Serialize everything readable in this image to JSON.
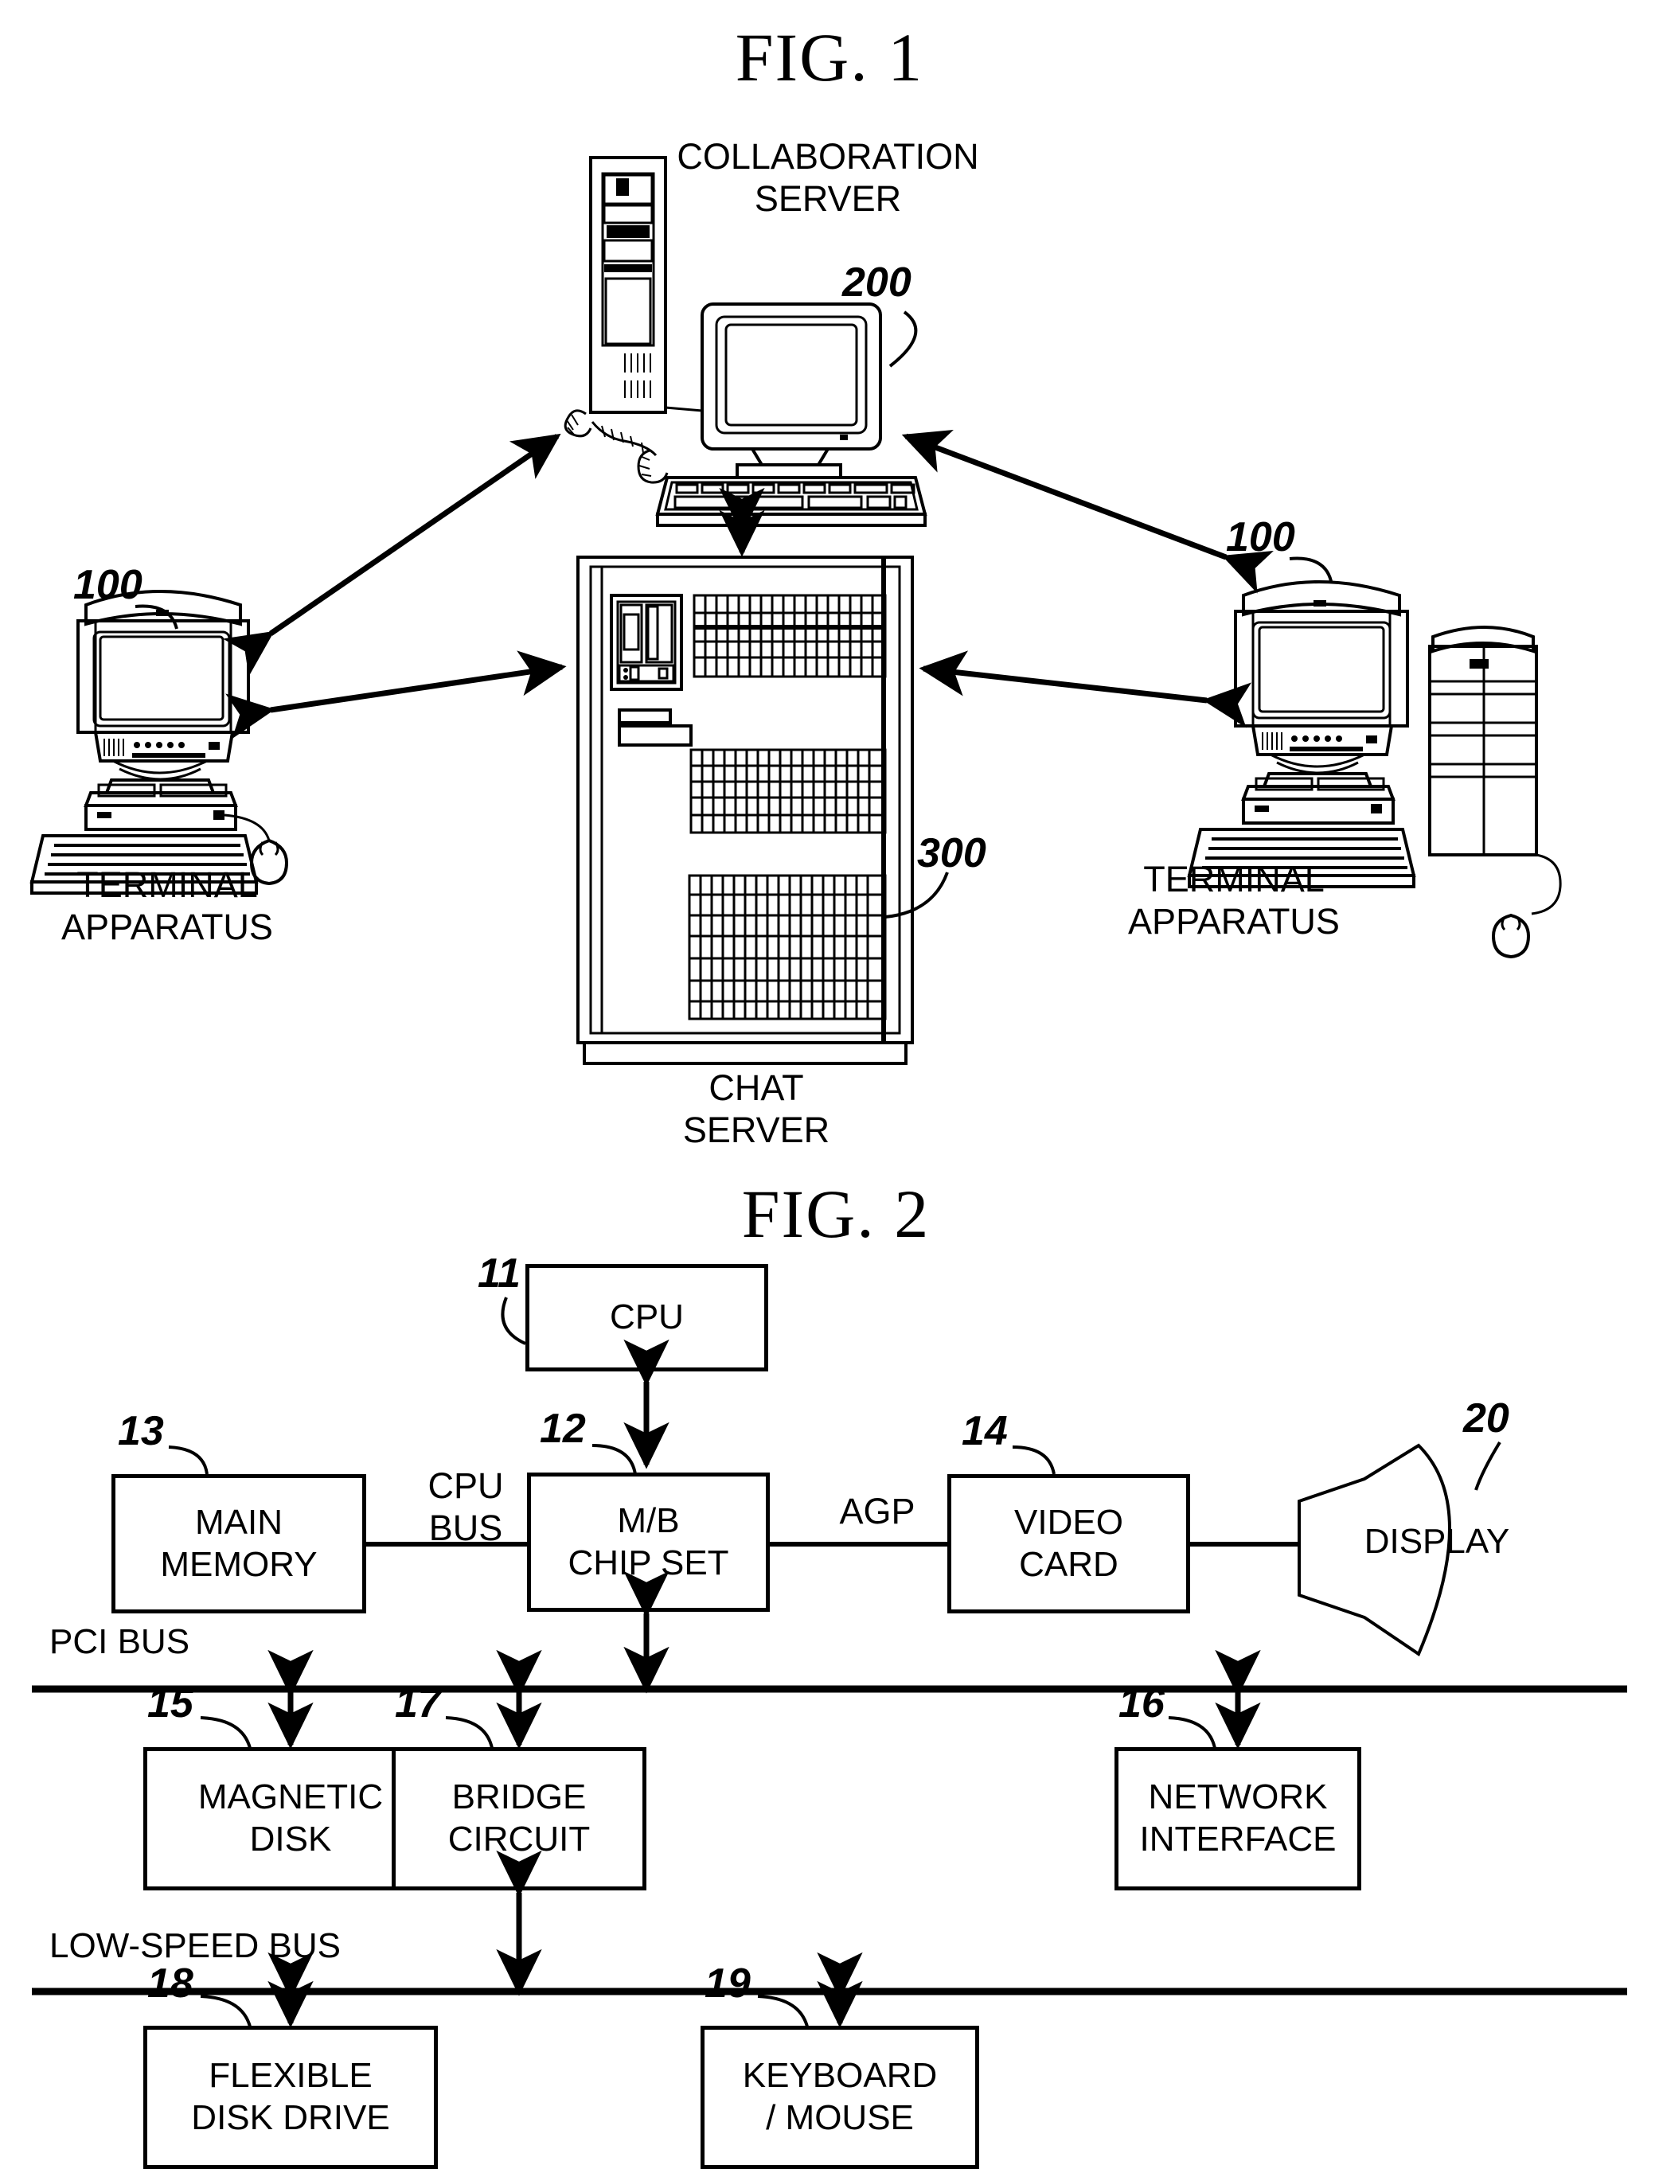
{
  "figures": [
    {
      "title": "FIG. 1",
      "nodes": {
        "collaboration_server": {
          "label": "COLLABORATION\nSERVER",
          "ref": "200"
        },
        "terminal_left": {
          "label": "TERMINAL\nAPPARATUS",
          "ref": "100"
        },
        "terminal_right": {
          "label": "TERMINAL\nAPPARATUS",
          "ref": "100"
        },
        "chat_server": {
          "label": "CHAT\nSERVER",
          "ref": "300"
        }
      }
    },
    {
      "title": "FIG. 2",
      "blocks": [
        {
          "key": "cpu",
          "label": "CPU",
          "ref": "11"
        },
        {
          "key": "chipset",
          "label": "M/B\nCHIP SET",
          "ref": "12"
        },
        {
          "key": "main_memory",
          "label": "MAIN\nMEMORY",
          "ref": "13"
        },
        {
          "key": "video_card",
          "label": "VIDEO\nCARD",
          "ref": "14"
        },
        {
          "key": "display",
          "label": "DISPLAY",
          "ref": "20"
        },
        {
          "key": "magnetic_disk",
          "label": "MAGNETIC\nDISK",
          "ref": "15"
        },
        {
          "key": "bridge",
          "label": "BRIDGE\nCIRCUIT",
          "ref": "17"
        },
        {
          "key": "network",
          "label": "NETWORK\nINTERFACE",
          "ref": "16"
        },
        {
          "key": "fdd",
          "label": "FLEXIBLE\nDISK DRIVE",
          "ref": "18"
        },
        {
          "key": "kbm",
          "label": "KEYBOARD\n/ MOUSE",
          "ref": "19"
        }
      ],
      "buses": [
        {
          "key": "cpu_bus",
          "label": "CPU\nBUS"
        },
        {
          "key": "agp",
          "label": "AGP"
        },
        {
          "key": "pci_bus",
          "label": "PCI BUS"
        },
        {
          "key": "low_speed",
          "label": "LOW-SPEED BUS"
        }
      ]
    }
  ],
  "colors": {
    "ink": "#000000",
    "paper": "#ffffff"
  }
}
